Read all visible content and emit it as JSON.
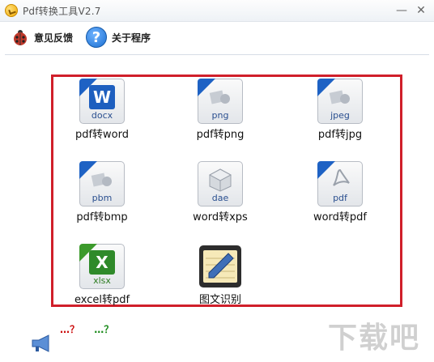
{
  "window": {
    "title": "Pdf转换工具V2.7",
    "minimize": "—",
    "close": "✕"
  },
  "toolbar": {
    "feedback_label": "意见反馈",
    "about_label": "关于程序",
    "help_glyph": "?"
  },
  "tiles": [
    {
      "label": "pdf转word",
      "ext": "docx",
      "icon": "word-doc-icon"
    },
    {
      "label": "pdf转png",
      "ext": "png",
      "icon": "png-image-icon"
    },
    {
      "label": "pdf转jpg",
      "ext": "jpeg",
      "icon": "jpeg-image-icon"
    },
    {
      "label": "pdf转bmp",
      "ext": "pbm",
      "icon": "bmp-image-icon"
    },
    {
      "label": "word转xps",
      "ext": "dae",
      "icon": "xps-doc-icon"
    },
    {
      "label": "word转pdf",
      "ext": "pdf",
      "icon": "pdf-doc-icon"
    },
    {
      "label": "excel转pdf",
      "ext": "xlsx",
      "icon": "excel-doc-icon"
    },
    {
      "label": "图文识别",
      "ext": "",
      "icon": "notepad-pen-icon"
    }
  ],
  "marquee": {
    "part1": "…？",
    "part2": "…？"
  },
  "watermark": "下载吧",
  "colors": {
    "panel_border": "#d01f2a",
    "word_blue": "#1e62c4",
    "excel_green": "#3c9a2c"
  }
}
